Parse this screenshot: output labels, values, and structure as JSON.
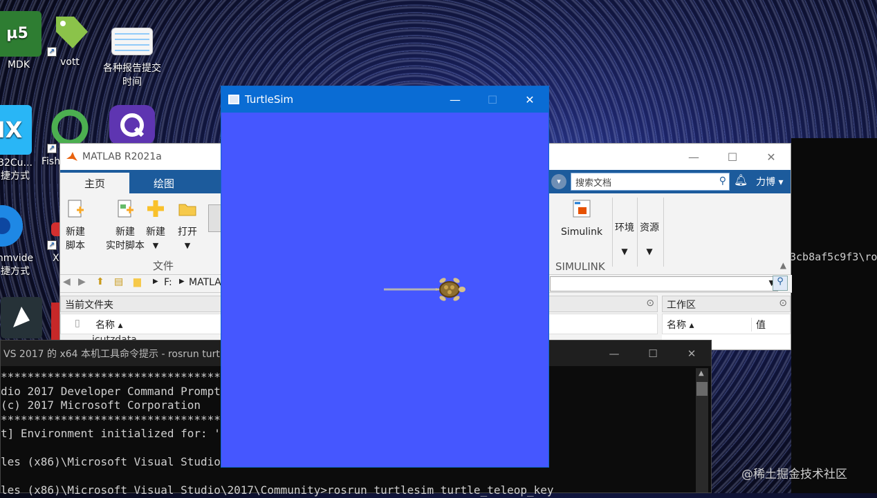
{
  "desktop": {
    "icons": [
      {
        "label": "MDK"
      },
      {
        "label": "vott"
      },
      {
        "label": "各种报告提交\n时间"
      },
      {
        "label": "32Cu...\n捷方式"
      },
      {
        "label": "Fish"
      },
      {
        "label": "nmvide\n捷方式"
      },
      {
        "label": "X"
      }
    ]
  },
  "matlab": {
    "title": "MATLAB R2021a",
    "tabs": [
      "主页",
      "绘图"
    ],
    "search_placeholder": "搜索文档",
    "user": "力博 ▾",
    "ribbon": {
      "new_script": "新建\n脚本",
      "new_live_script": "新建\n实时脚本",
      "new": "新建",
      "open": "打开",
      "file_group": "文件",
      "simulink": "Simulink",
      "simulink_group": "SIMULINK",
      "environment": "环境",
      "resources": "资源"
    },
    "address": {
      "drive": "F:",
      "path": "MATLA"
    },
    "current_folder": {
      "title": "当前文件夹",
      "name_col": "名称 ▴",
      "first_row": "icutzdata"
    },
    "workspace": {
      "title": "工作区",
      "name_col": "名称 ▴",
      "value_col": "值"
    }
  },
  "turtlesim": {
    "title": "TurtleSim",
    "background_color": "#4557ff"
  },
  "cmd": {
    "title": "VS 2017 的 x64 本机工具命令提示 - rosrun  turtle",
    "lines": [
      "**************************************************************",
      "dio 2017 Developer Command Prompt v",
      "(c) 2017 Microsoft Corporation",
      "**************************************************************",
      "t] Environment initialized for: 'x6",
      "",
      "les (x86)\\Microsoft Visual Studio\\2",
      "",
      "les (x86)\\Microsoft Visual Studio\\2017\\Community>rosrun turtlesim turtle_teleop_key"
    ]
  },
  "right_console": {
    "text": "3cb8af5c9f3\\ro"
  },
  "watermark": "@稀土掘金技术社区"
}
